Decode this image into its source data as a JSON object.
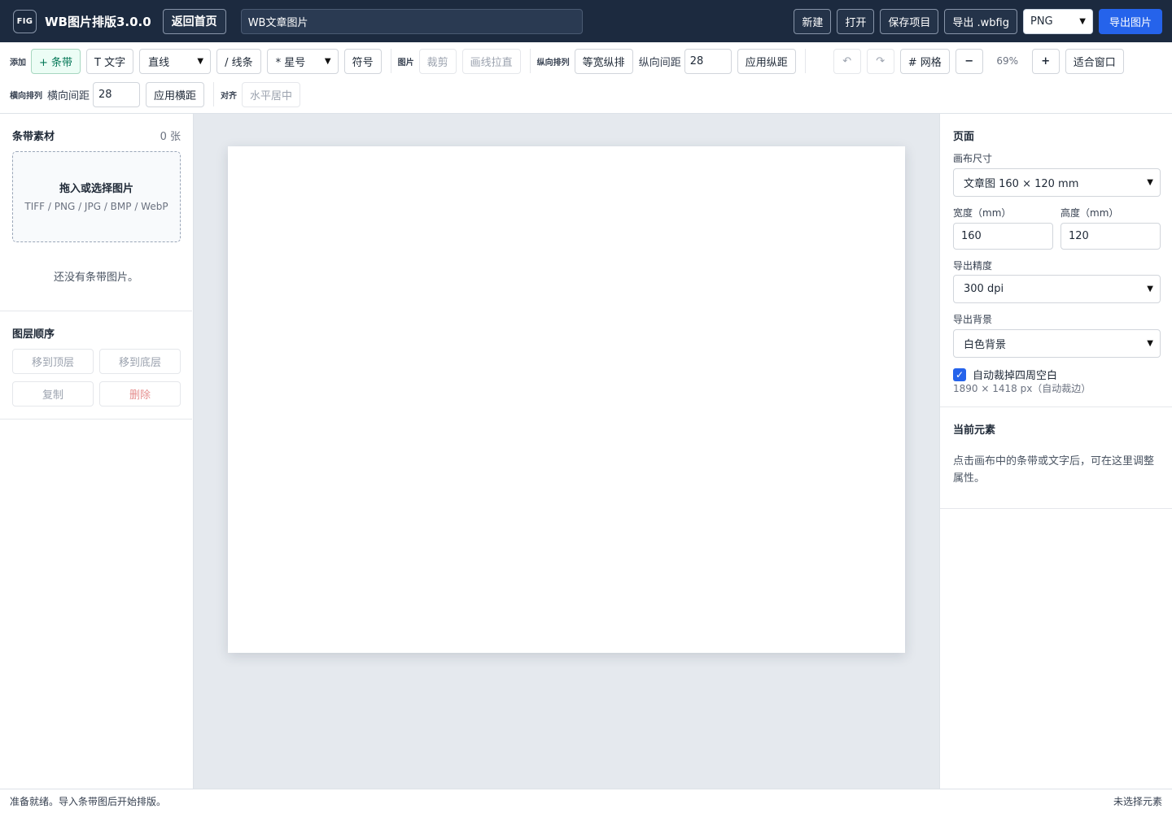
{
  "header": {
    "logo": "FIG",
    "title": "WB图片排版3.0.0",
    "home_button": "返回首页",
    "project_name": "WB文章图片",
    "new_button": "新建",
    "open_button": "打开",
    "save_button": "保存项目",
    "export_wbfig_button": "导出 .wbfig",
    "format_value": "PNG",
    "export_image_button": "导出图片"
  },
  "toolbar": {
    "add_label": "添加",
    "add_strip": "+ 条带",
    "add_text": "T 文字",
    "line_select": "直线",
    "add_line": "/ 线条",
    "star_select": "* 星号",
    "symbol_button": "符号",
    "image_label": "图片",
    "crop_button": "裁剪",
    "draw_stretch_button": "画线拉直",
    "vertical_label": "纵向排列",
    "equal_width_button": "等宽纵排",
    "vertical_gap_label": "纵向间距",
    "vertical_gap_value": "28",
    "apply_vertical_button": "应用纵距",
    "undo_icon": "↶",
    "redo_icon": "↷",
    "grid_button": "# 网格",
    "zoom_out": "−",
    "zoom_value": "69%",
    "zoom_in": "+",
    "fit_button": "适合窗口",
    "horizontal_label": "横向排列",
    "horizontal_gap_label": "横向间距",
    "horizontal_gap_value": "28",
    "apply_horizontal_button": "应用横距",
    "align_label": "对齐",
    "center_h_button": "水平居中"
  },
  "left_panel": {
    "materials_title": "条带素材",
    "materials_count": "0 张",
    "drop_title": "拖入或选择图片",
    "drop_formats": "TIFF / PNG / JPG / BMP / WebP",
    "empty_message": "还没有条带图片。",
    "layer_title": "图层顺序",
    "move_top": "移到顶层",
    "move_bottom": "移到底层",
    "duplicate": "复制",
    "delete": "删除"
  },
  "right_panel": {
    "page_title": "页面",
    "canvas_size_label": "画布尺寸",
    "canvas_size_value": "文章图 160 × 120 mm",
    "width_label": "宽度（mm）",
    "width_value": "160",
    "height_label": "高度（mm）",
    "height_value": "120",
    "precision_label": "导出精度",
    "precision_value": "300 dpi",
    "background_label": "导出背景",
    "background_value": "白色背景",
    "auto_crop_label": "自动裁掉四周空白",
    "auto_crop_checked": true,
    "export_size_note": "1890 × 1418 px（自动裁边）",
    "element_title": "当前元素",
    "element_hint": "点击画布中的条带或文字后，可在这里调整属性。"
  },
  "status": {
    "left": "准备就绪。导入条带图后开始排版。",
    "right": "未选择元素"
  },
  "colors": {
    "header_bg": "#1c2a3f",
    "accent": "#2563eb",
    "canvas_bg": "#e5e9ee"
  }
}
